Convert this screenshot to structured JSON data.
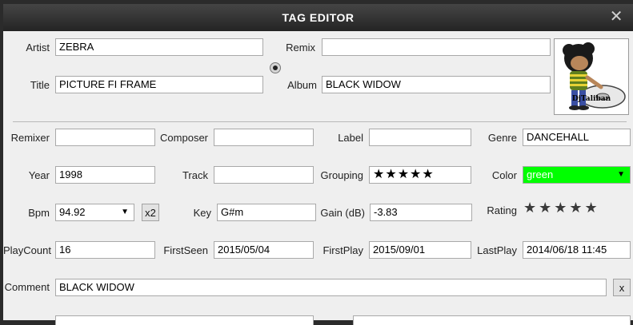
{
  "window": {
    "title": "TAG EDITOR",
    "close_glyph": "✕"
  },
  "fields": {
    "artist": {
      "label": "Artist",
      "value": "ZEBRA"
    },
    "remix": {
      "label": "Remix",
      "value": ""
    },
    "title": {
      "label": "Title",
      "value": "PICTURE FI FRAME"
    },
    "album": {
      "label": "Album",
      "value": "BLACK WIDOW"
    },
    "remixer": {
      "label": "Remixer",
      "value": ""
    },
    "composer": {
      "label": "Composer",
      "value": ""
    },
    "label": {
      "label": "Label",
      "value": ""
    },
    "genre": {
      "label": "Genre",
      "value": "DANCEHALL"
    },
    "year": {
      "label": "Year",
      "value": "1998"
    },
    "track": {
      "label": "Track",
      "value": ""
    },
    "grouping": {
      "label": "Grouping",
      "value": "★★★★★"
    },
    "color": {
      "label": "Color",
      "value": "green",
      "swatch": "#00ff00"
    },
    "bpm": {
      "label": "Bpm",
      "value": "94.92",
      "x2_label": "x2"
    },
    "key": {
      "label": "Key",
      "value": "G#m"
    },
    "gain": {
      "label": "Gain (dB)",
      "value": "-3.83"
    },
    "rating": {
      "label": "Rating",
      "stars": "★★★★★",
      "value": 0
    },
    "playcount": {
      "label": "PlayCount",
      "value": "16"
    },
    "firstseen": {
      "label": "FirstSeen",
      "value": "2015/05/04"
    },
    "firstplay": {
      "label": "FirstPlay",
      "value": "2015/09/01"
    },
    "lastplay": {
      "label": "LastPlay",
      "value": "2014/06/18 11:45"
    },
    "comment": {
      "label": "Comment",
      "value": "BLACK WIDOW",
      "clear_label": "x"
    }
  },
  "cover": {
    "text": "DjTaliban"
  },
  "icons": {
    "close": "close-icon",
    "dropdown": "chevron-down-icon",
    "radio": "radio-icon"
  }
}
